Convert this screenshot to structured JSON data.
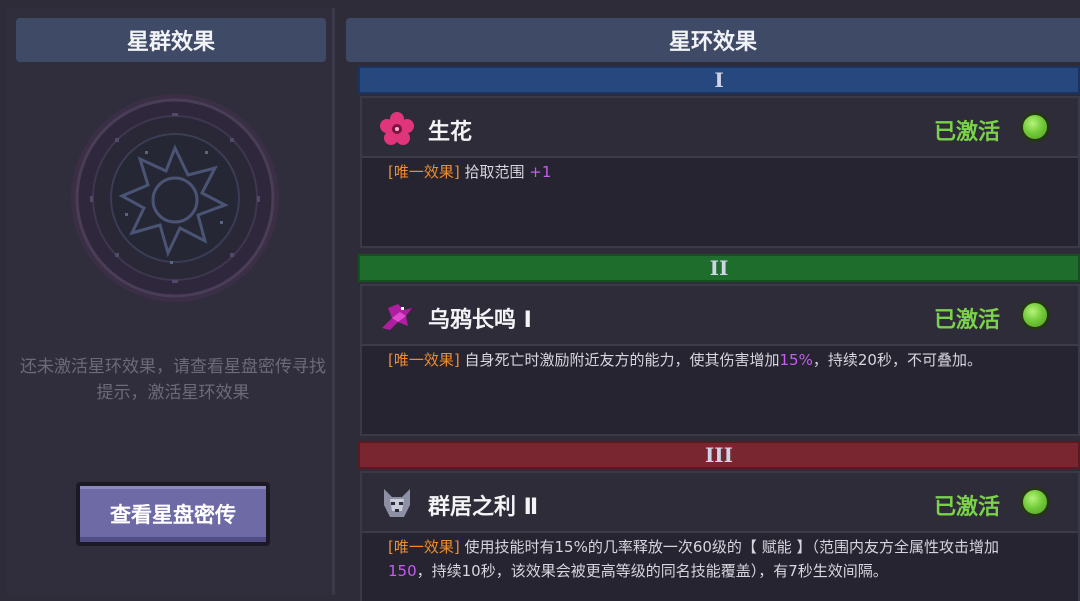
{
  "left": {
    "title": "星群效果",
    "hint": "还未激活星环效果，请查看星盘密传寻找提示，激活星环效果",
    "button_label": "查看星盘密传"
  },
  "right": {
    "title": "星环效果",
    "tiers": [
      {
        "numeral": "I",
        "color": "#26487e",
        "skill": {
          "icon": "pink-flower-icon",
          "name": "生花",
          "status": "已激活",
          "tag": "[唯一效果]",
          "desc_a": "拾取范围",
          "desc_hl": "+1",
          "desc_b": ""
        }
      },
      {
        "numeral": "II",
        "color": "#1f6d2c",
        "skill": {
          "icon": "crow-icon",
          "name": "乌鸦长鸣 Ⅰ",
          "status": "已激活",
          "tag": "[唯一效果]",
          "desc_a": "自身死亡时激励附近友方的能力，使其伤害增加",
          "desc_hl": "15%",
          "desc_b": "，持续20秒，不可叠加。"
        }
      },
      {
        "numeral": "III",
        "color": "#7a2630",
        "skill": {
          "icon": "wolf-icon",
          "name": "群居之利 Ⅱ",
          "status": "已激活",
          "tag": "[唯一效果]",
          "desc_a": "使用技能时有15%的几率释放一次60级的【 赋能 】（范围内友方全属性攻击增加",
          "desc_hl": "150",
          "desc_b": "，持续10秒，该效果会被更高等级的同名技能覆盖），有7秒生效间隔。"
        }
      }
    ]
  },
  "colors": {
    "active_green": "#7ad14a",
    "tag_orange": "#ef8c2e",
    "highlight_purple": "#c65cf0",
    "header_blue": "#3e4a66"
  }
}
